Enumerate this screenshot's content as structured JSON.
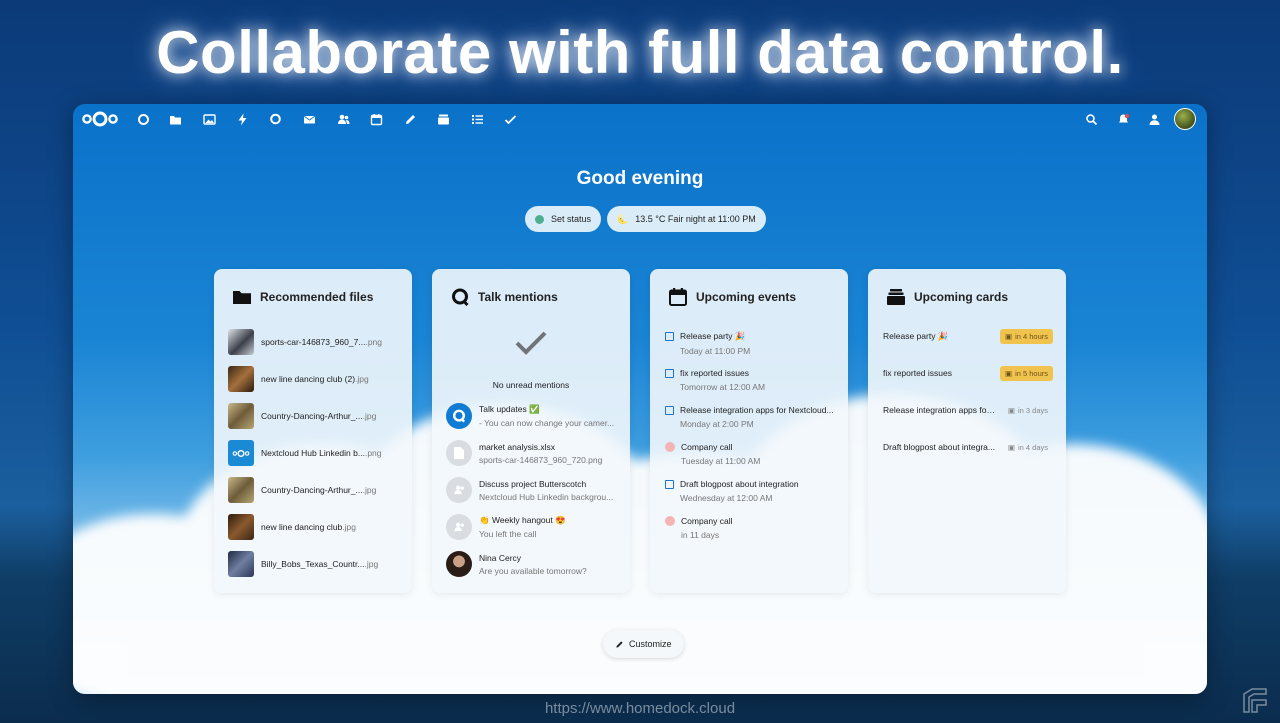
{
  "headline": "Collaborate with full data control.",
  "url_watermark": "https://www.homedock.cloud",
  "topbar": {
    "logo": "nextcloud-logo",
    "apps": [
      "dashboard-icon",
      "files-icon",
      "photos-icon",
      "activity-icon",
      "talk-icon",
      "mail-icon",
      "contacts-icon",
      "calendar-icon",
      "notes-icon",
      "deck-icon",
      "tasks-list-icon",
      "checkmark-icon"
    ],
    "right": [
      "search-icon",
      "notifications-icon",
      "contacts-menu-icon",
      "user-avatar"
    ]
  },
  "greeting": "Good evening",
  "status": {
    "set_status": "Set status",
    "weather": "13.5 °C Fair night at 11:00 PM",
    "weather_icon": "🌜"
  },
  "panels": {
    "files": {
      "title": "Recommended files",
      "items": [
        {
          "name": "sports-car-146873_960_7...",
          "ext": "png",
          "thumb": "#3b3f4a"
        },
        {
          "name": "new line dancing club (2)",
          "ext": "jpg",
          "thumb": "#6a4a2c"
        },
        {
          "name": "Country-Dancing-Arthur_...",
          "ext": "jpg",
          "thumb": "#8a7a52"
        },
        {
          "name": "Nextcloud Hub Linkedin b...",
          "ext": "png",
          "thumb": "#1a8ad4"
        },
        {
          "name": "Country-Dancing-Arthur_...",
          "ext": "jpg",
          "thumb": "#8a7a52"
        },
        {
          "name": "new line dancing club",
          "ext": "jpg",
          "thumb": "#5c3f24"
        },
        {
          "name": "Billy_Bobs_Texas_Countr...",
          "ext": "jpg",
          "thumb": "#3a4a6a"
        }
      ]
    },
    "talk": {
      "title": "Talk mentions",
      "empty": "No unread mentions",
      "items": [
        {
          "title": "Talk updates ✅",
          "sub": "- You can now change your camer...",
          "avatar": "talk"
        },
        {
          "title": "market analysis.xlsx",
          "sub": "sports-car-146873_960_720.png",
          "avatar": "file"
        },
        {
          "title": "Discuss project Butterscotch",
          "sub": "Nextcloud Hub Linkedin backgrou...",
          "avatar": "group"
        },
        {
          "title": "👏 Weekly hangout 😍",
          "sub": "You left the call",
          "avatar": "group"
        },
        {
          "title": "Nina Cercy",
          "sub": "Are you available tomorrow?",
          "avatar": "person"
        }
      ]
    },
    "events": {
      "title": "Upcoming events",
      "items": [
        {
          "title": "Release party 🎉",
          "when": "Today at 11:00 PM",
          "kind": "task"
        },
        {
          "title": "fix reported issues",
          "when": "Tomorrow at 12:00 AM",
          "kind": "task"
        },
        {
          "title": "Release integration apps for Nextcloud...",
          "when": "Monday at 2:00 PM",
          "kind": "task"
        },
        {
          "title": "Company call",
          "when": "Tuesday at 11:00 AM",
          "kind": "event"
        },
        {
          "title": "Draft blogpost about integration",
          "when": "Wednesday at 12:00 AM",
          "kind": "task"
        },
        {
          "title": "Company call",
          "when": "in 11 days",
          "kind": "event"
        }
      ]
    },
    "cards": {
      "title": "Upcoming cards",
      "items": [
        {
          "title": "Release party 🎉",
          "due": "in 4 hours",
          "style": "warn"
        },
        {
          "title": "fix reported issues",
          "due": "in 5 hours",
          "style": "warn"
        },
        {
          "title": "Release integration apps for...",
          "due": "in 3 days",
          "style": "plain"
        },
        {
          "title": "Draft blogpost about integra...",
          "due": "in 4 days",
          "style": "plain"
        }
      ]
    }
  },
  "customize": "Customize"
}
